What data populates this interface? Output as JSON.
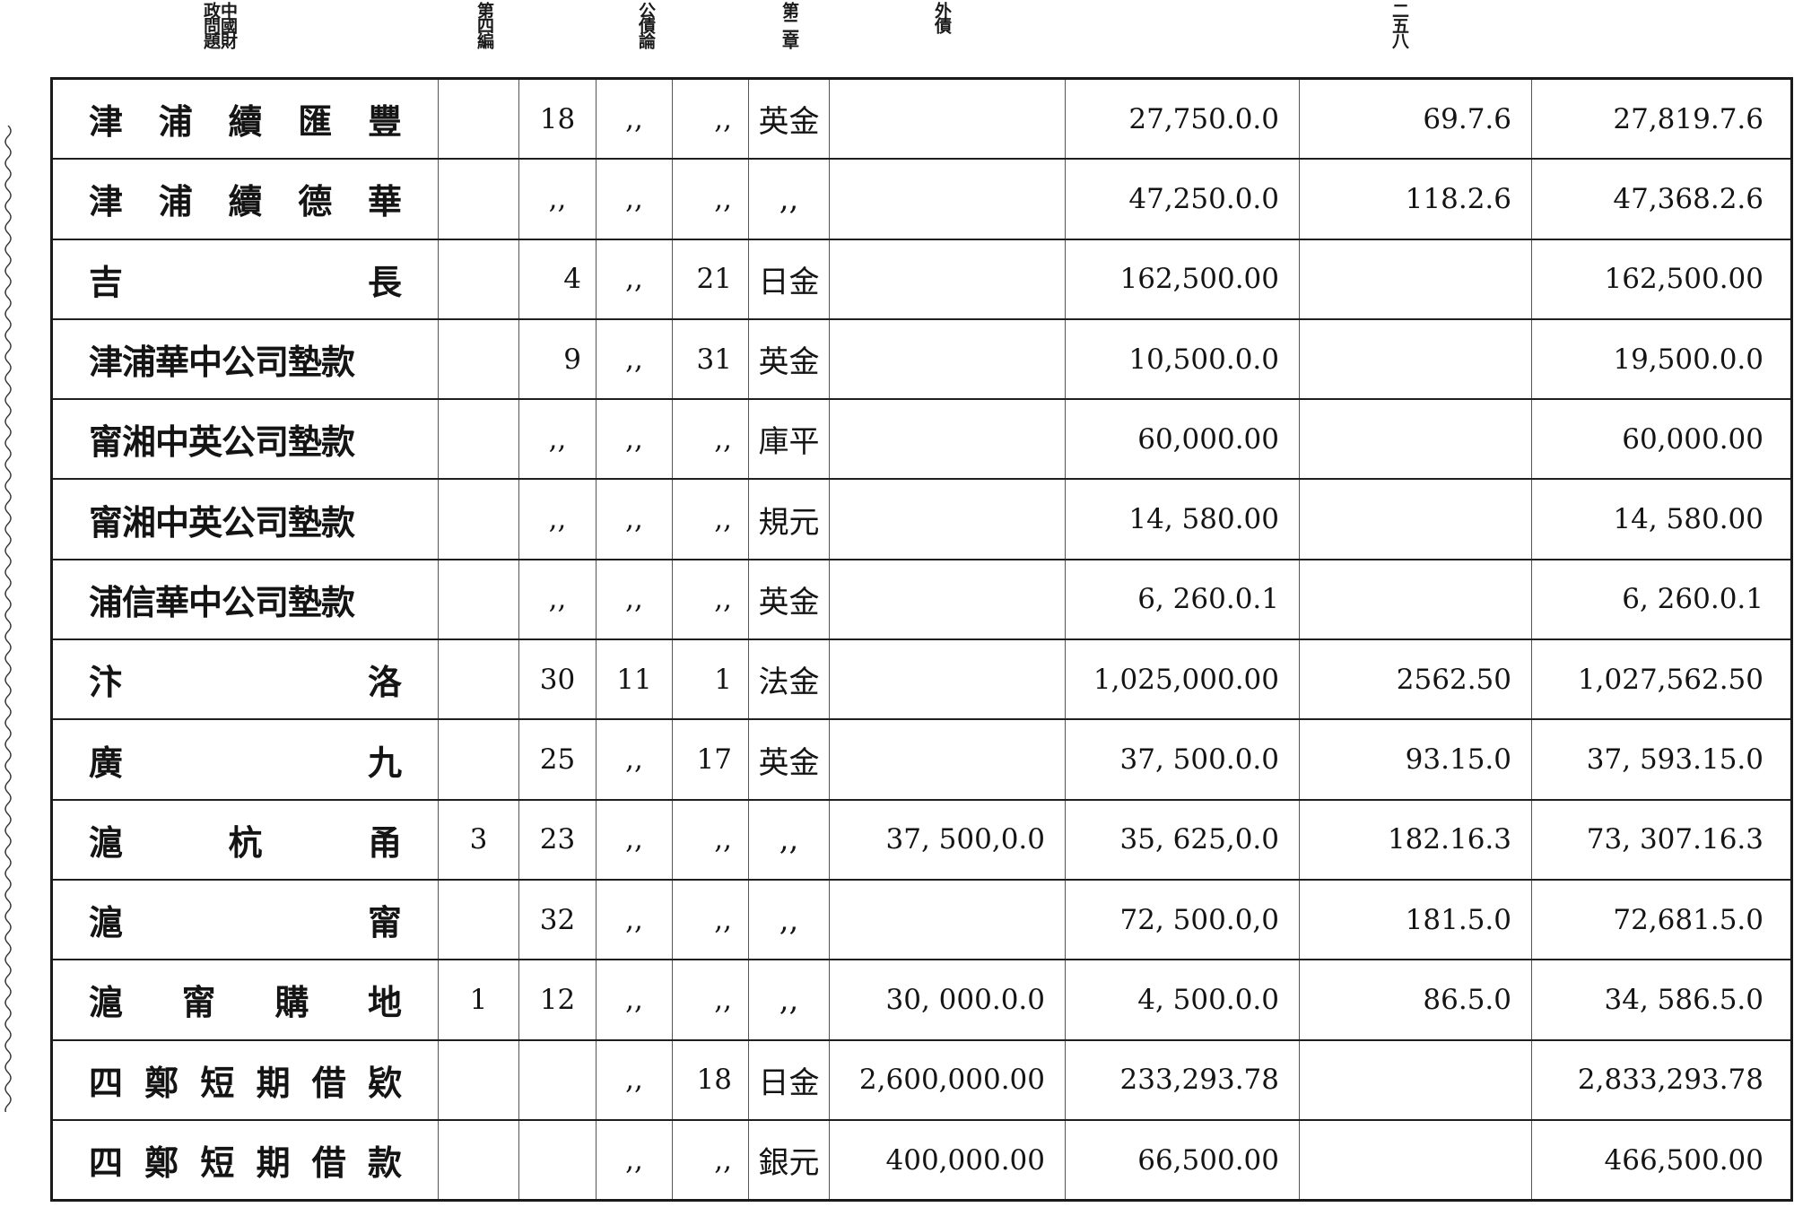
{
  "header": {
    "book": "中國財政問題",
    "part": "第四編",
    "topic": "公債論",
    "chapter": "第二章",
    "section": "外債",
    "page_number": "二五八"
  },
  "rows": [
    {
      "name": "津浦續匯豐",
      "c1": "",
      "c2": "18",
      "c3": ",,",
      "c4": ",,",
      "currency": "英金",
      "col_a": "",
      "col_b": "27,750.0.0",
      "col_c": "69.7.6",
      "total": "27,819.7.6"
    },
    {
      "name": "津浦續德華",
      "c1": "",
      "c2": ",,",
      "c3": ",,",
      "c4": ",,",
      "currency": ",,",
      "col_a": "",
      "col_b": "47,250.0.0",
      "col_c": "118.2.6",
      "total": "47,368.2.6"
    },
    {
      "name": "吉長",
      "c1": "",
      "c2": "4",
      "c3": ",,",
      "c4": "21",
      "currency": "日金",
      "col_a": "",
      "col_b": "162,500.00",
      "col_c": "",
      "total": "162,500.00"
    },
    {
      "name": "津浦華中公司墊款",
      "c1": "",
      "c2": "9",
      "c3": ",,",
      "c4": "31",
      "currency": "英金",
      "col_a": "",
      "col_b": "10,500.0.0",
      "col_c": "",
      "total": "19,500.0.0"
    },
    {
      "name": "甯湘中英公司墊款",
      "c1": "",
      "c2": ",,",
      "c3": ",,",
      "c4": ",,",
      "currency": "庫平",
      "col_a": "",
      "col_b": "60,000.00",
      "col_c": "",
      "total": "60,000.00"
    },
    {
      "name": "甯湘中英公司墊款",
      "c1": "",
      "c2": ",,",
      "c3": ",,",
      "c4": ",,",
      "currency": "規元",
      "col_a": "",
      "col_b": "14, 580.00",
      "col_c": "",
      "total": "14, 580.00"
    },
    {
      "name": "浦信華中公司墊款",
      "c1": "",
      "c2": ",,",
      "c3": ",,",
      "c4": ",,",
      "currency": "英金",
      "col_a": "",
      "col_b": "6, 260.0.1",
      "col_c": "",
      "total": "6, 260.0.1"
    },
    {
      "name": "汴洛",
      "c1": "",
      "c2": "30",
      "c3": "11",
      "c4": "1",
      "currency": "法金",
      "col_a": "",
      "col_b": "1,025,000.00",
      "col_c": "2562.50",
      "total": "1,027,562.50"
    },
    {
      "name": "廣九",
      "c1": "",
      "c2": "25",
      "c3": ",,",
      "c4": "17",
      "currency": "英金",
      "col_a": "",
      "col_b": "37, 500.0.0",
      "col_c": "93.15.0",
      "total": "37, 593.15.0"
    },
    {
      "name": "滬杭甬",
      "c1": "3",
      "c2": "23",
      "c3": ",,",
      "c4": ",,",
      "currency": ",,",
      "col_a": "37, 500,0.0",
      "col_b": "35, 625,0.0",
      "col_c": "182.16.3",
      "total": "73, 307.16.3"
    },
    {
      "name": "滬甯",
      "c1": "",
      "c2": "32",
      "c3": ",,",
      "c4": ",,",
      "currency": ",,",
      "col_a": "",
      "col_b": "72, 500.0,0",
      "col_c": "181.5.0",
      "total": "72,681.5.0"
    },
    {
      "name": "滬甯購地",
      "c1": "1",
      "c2": "12",
      "c3": ",,",
      "c4": ",,",
      "currency": ",,",
      "col_a": "30, 000.0.0",
      "col_b": "4, 500.0.0",
      "col_c": "86.5.0",
      "total": "34, 586.5.0"
    },
    {
      "name": "四鄭短期借欵",
      "c1": "",
      "c2": "",
      "c3": ",,",
      "c4": "18",
      "currency": "日金",
      "col_a": "2,600,000.00",
      "col_b": "233,293.78",
      "col_c": "",
      "total": "2,833,293.78"
    },
    {
      "name": "四鄭短期借款",
      "c1": "",
      "c2": "",
      "c3": ",,",
      "c4": ",,",
      "currency": "銀元",
      "col_a": "400,000.00",
      "col_b": "66,500.00",
      "col_c": "",
      "total": "466,500.00"
    }
  ]
}
